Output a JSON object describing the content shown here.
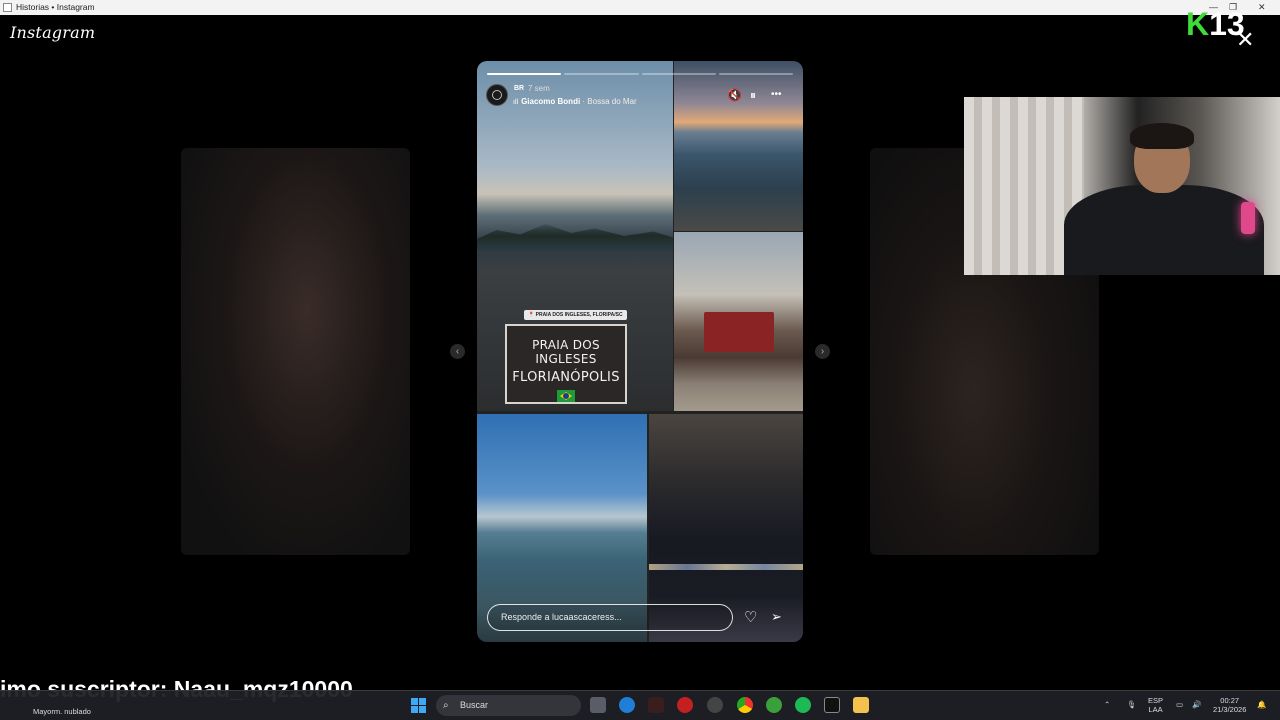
{
  "window": {
    "title": "Historias • Instagram",
    "minimize": "—",
    "restore": "❐",
    "close": "✕"
  },
  "app": {
    "logo": "Instagram"
  },
  "nav": {
    "prev": "‹",
    "next": "›"
  },
  "story": {
    "progress_segments": 4,
    "active_segment": 1,
    "username": "BR",
    "time": "7 sem",
    "music": {
      "artist": "Giacomo Bondi",
      "separator": " · ",
      "song": "Bossa do Mar"
    },
    "controls": {
      "mute": "🔇",
      "pause": "⏸",
      "more": "•••"
    },
    "location_tag": "PRAIA DOS INGLESES, FLORIPA/SC",
    "sticker": {
      "line1": "PRAIA DOS INGLESES",
      "line2": "FLORIANÓPOLIS"
    },
    "reply_placeholder": "Responde a lucaascaceress...",
    "like_icon": "♡",
    "share_icon": "➢"
  },
  "overlay": {
    "brand_letter": "K",
    "brand_number": "13",
    "close": "✕",
    "subscriber_text": "imo suscriptor: Naau_mqz10000"
  },
  "taskbar": {
    "weather": "Mayorm. nublado",
    "search": "Buscar",
    "lang_top": "ESP",
    "lang_bottom": "LAA",
    "time": "00:27",
    "date": "21/3/2026",
    "apps": [
      "task-view",
      "edge",
      "app-1",
      "app-2",
      "app-3",
      "chrome",
      "xbox",
      "spotify",
      "capcut",
      "explorer"
    ]
  },
  "colors": {
    "brand_green": "#3ddc38",
    "windows_blue": "#3fa9f5",
    "background": "#000000"
  }
}
